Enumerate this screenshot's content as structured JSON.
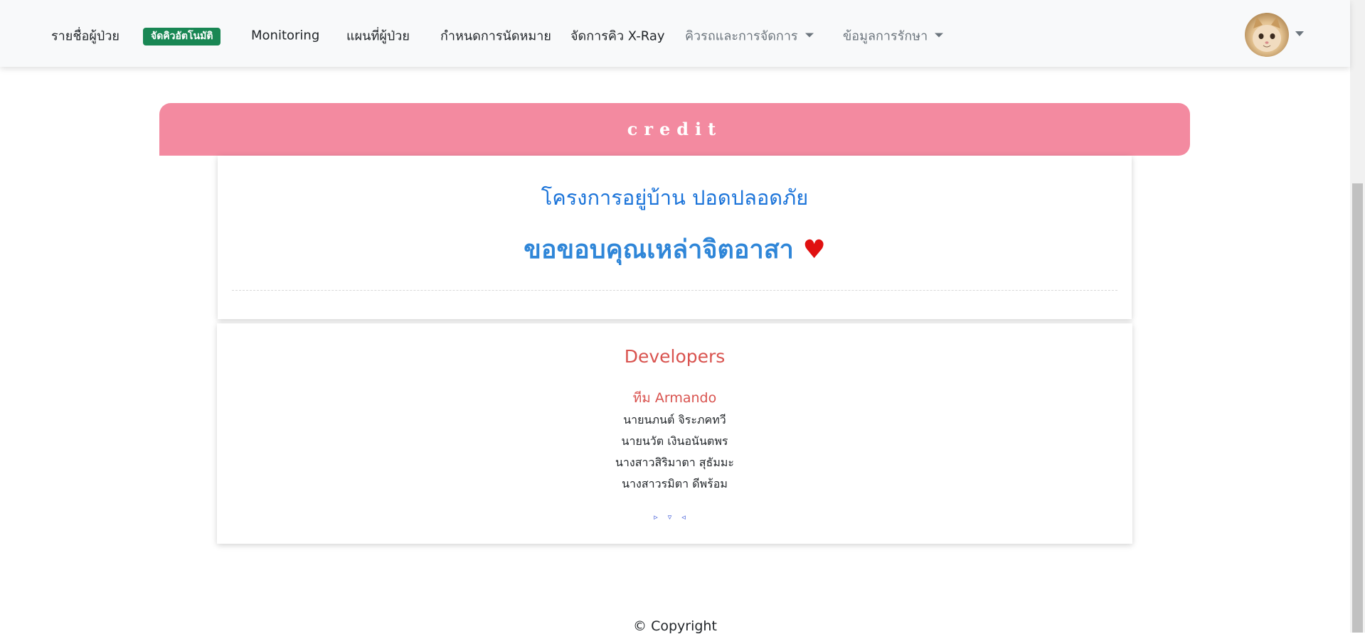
{
  "navbar": {
    "items": [
      {
        "label": "รายชื่อผู้ป่วย"
      },
      {
        "label": "จัดคิวอัตโนมัติ"
      },
      {
        "label": "Monitoring"
      },
      {
        "label": "แผนที่ผู้ป่วย"
      },
      {
        "label": "กำหนดการนัดหมาย"
      },
      {
        "label": "จัดการคิว X-Ray"
      },
      {
        "label": "คิวรถและการจัดการ"
      },
      {
        "label": "ข้อมูลการรักษา"
      }
    ],
    "badge_color": "#198754"
  },
  "banner": {
    "label": "credit",
    "color": "#f38aa0"
  },
  "credit_card": {
    "project": "โครงการอยู่บ้าน ปอดปลอดภัย",
    "thanks": "ขอขอบคุณเหล่าจิตอาสา",
    "heart": "♥"
  },
  "developers": {
    "title": "Developers",
    "team": "ทีม Armando",
    "members": [
      "นายนภนต์ จิระภคทวี",
      "นายนวัต เงินอนันตพร",
      "นางสาวสิริมาตา สุธัมมะ",
      "นางสาวรมิตา ดีพร้อม"
    ],
    "decor": "▹▿◃"
  },
  "footer": {
    "copyright": "© Copyright"
  }
}
